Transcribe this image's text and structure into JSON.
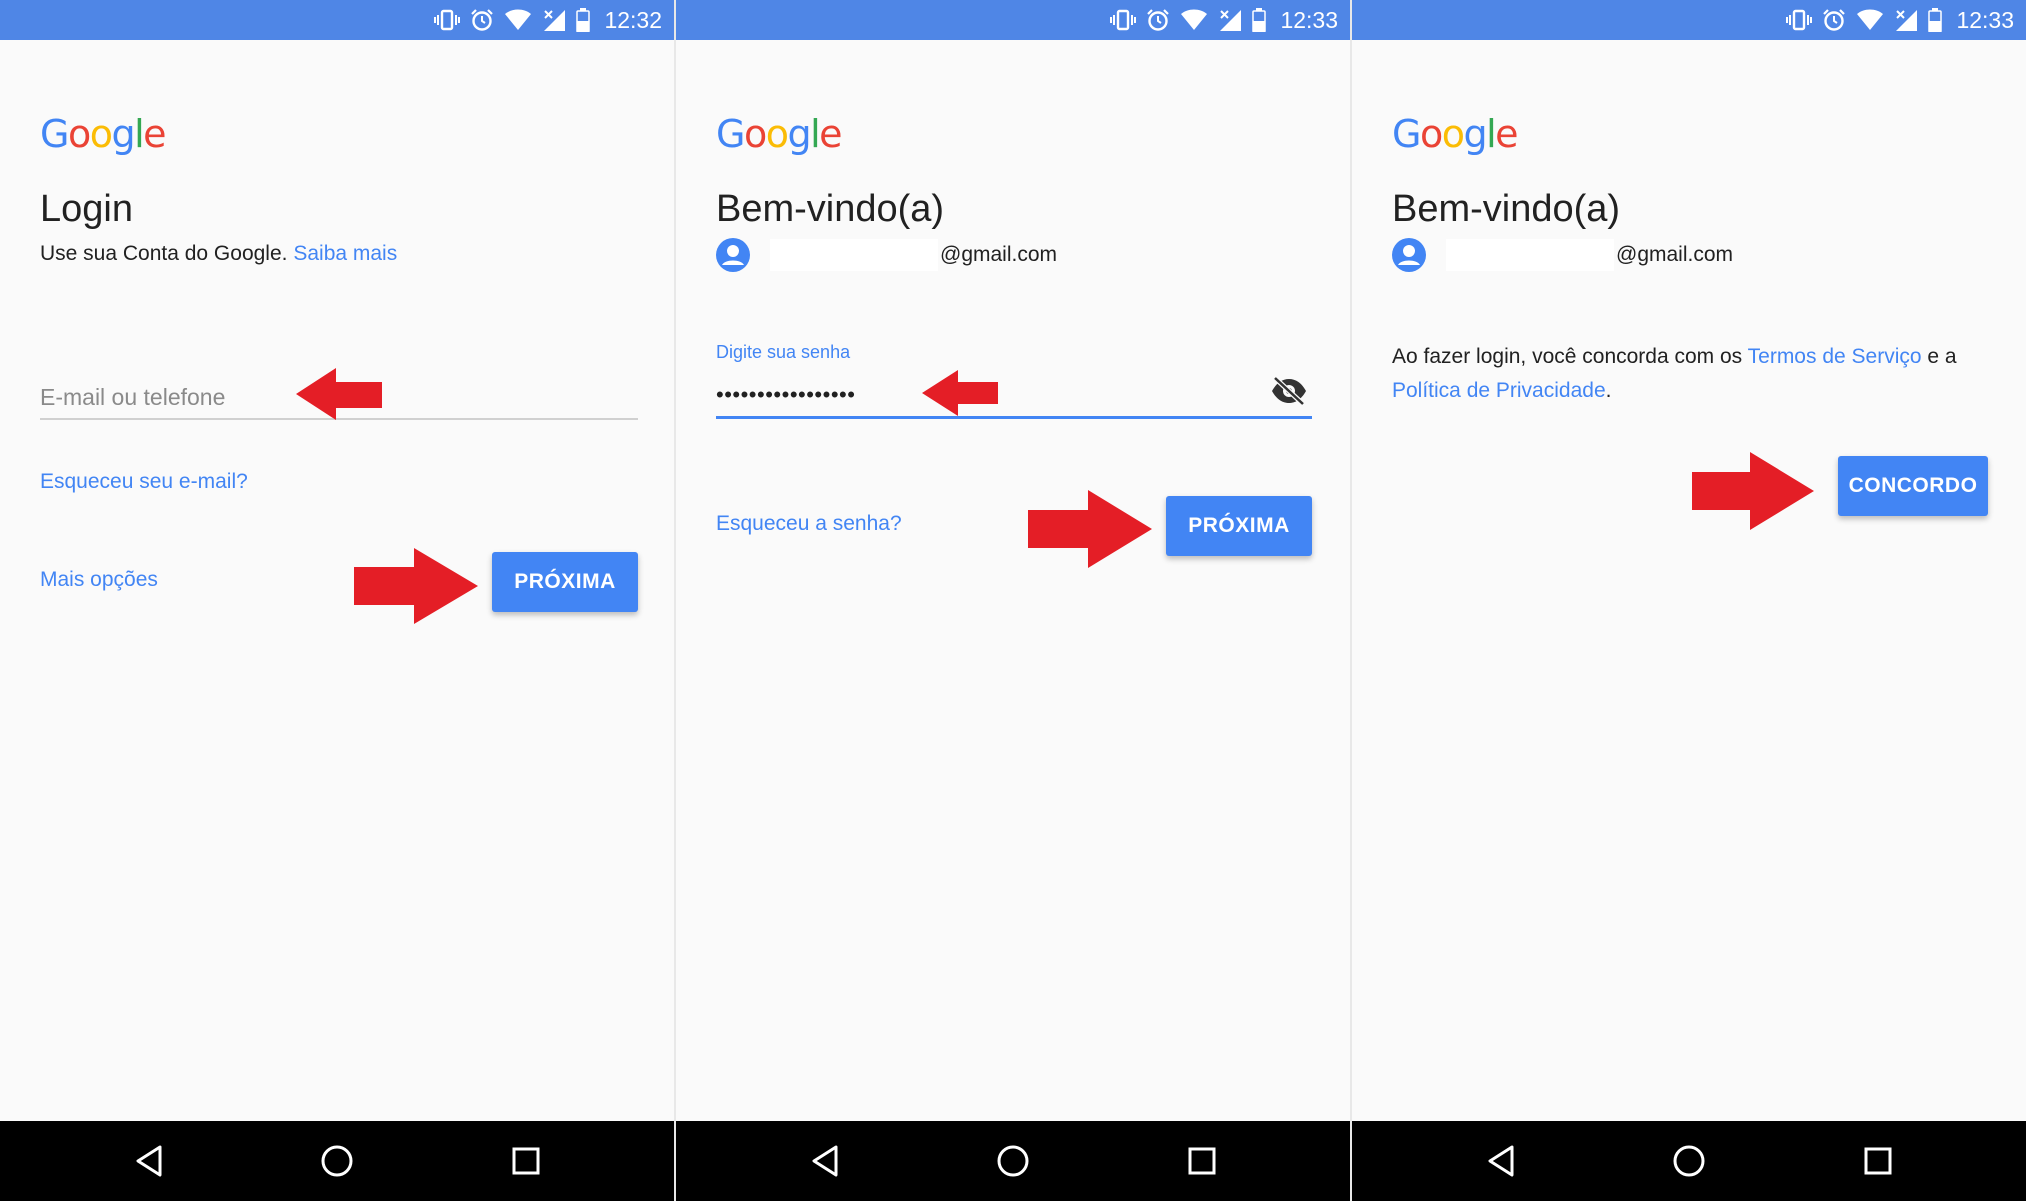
{
  "screens": [
    {
      "status_time": "12:32",
      "logo": [
        "G",
        "o",
        "o",
        "g",
        "l",
        "e"
      ],
      "title": "Login",
      "subtitle": "Use sua Conta do Google.",
      "subtitle_link": "Saiba mais",
      "input_placeholder": "E-mail ou telefone",
      "forgot_link": "Esqueceu seu e-mail?",
      "more_options_link": "Mais opções",
      "next_button": "PRÓXIMA"
    },
    {
      "status_time": "12:33",
      "logo": [
        "G",
        "o",
        "o",
        "g",
        "l",
        "e"
      ],
      "title": "Bem-vindo(a)",
      "account_email": "@gmail.com",
      "password_label": "Digite sua senha",
      "password_value": "•••••••••••••••••",
      "forgot_link": "Esqueceu a senha?",
      "next_button": "PRÓXIMA"
    },
    {
      "status_time": "12:33",
      "logo": [
        "G",
        "o",
        "o",
        "g",
        "l",
        "e"
      ],
      "title": "Bem-vindo(a)",
      "account_email": "@gmail.com",
      "agree_text_1": "Ao fazer login, você concorda com os ",
      "terms_link": "Termos de Serviço",
      "agree_text_2": " e a ",
      "privacy_link": "Política de Privacidade",
      "agree_text_3": ".",
      "agree_button": "CONCORDO"
    }
  ],
  "icons": {
    "status": [
      "vibrate-icon",
      "alarm-icon",
      "wifi-icon",
      "signal-icon",
      "battery-icon"
    ],
    "nav": [
      "back-icon",
      "home-icon",
      "recents-icon"
    ],
    "account": "account-circle-icon",
    "visibility": "visibility-off-icon",
    "annotation": "red-arrow-icon"
  },
  "colors": {
    "status_bar": "#4f86e6",
    "accent": "#4285f4",
    "arrow": "#e41e26",
    "background": "#fafafa",
    "nav_bar": "#000000"
  }
}
